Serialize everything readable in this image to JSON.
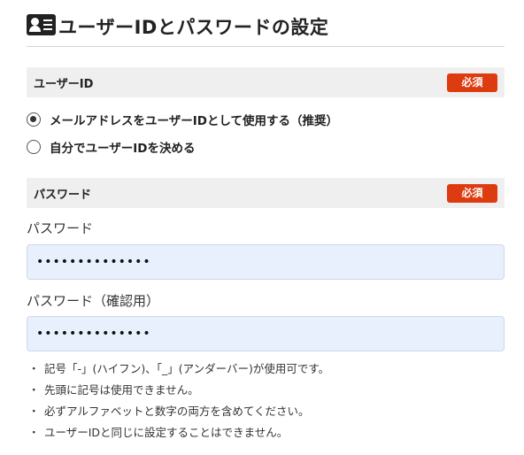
{
  "header": {
    "icon": "id-card-icon",
    "title": "ユーザーIDとパスワードの設定"
  },
  "userid_section": {
    "label": "ユーザーID",
    "required_label": "必須",
    "options": [
      {
        "label": "メールアドレスをユーザーIDとして使用する（推奨）",
        "checked": true
      },
      {
        "label": "自分でユーザーIDを決める",
        "checked": false
      }
    ]
  },
  "password_section": {
    "label": "パスワード",
    "required_label": "必須",
    "password_label": "パスワード",
    "password_value": "••••••••••••••",
    "confirm_label": "パスワード（確認用）",
    "confirm_value": "••••••••••••••"
  },
  "notes": {
    "bullet": "・",
    "items": [
      "記号「-」(ハイフン)、「_」(アンダーバー)が使用可です。",
      "先頭に記号は使用できません。",
      "必ずアルファベットと数字の両方を含めてください。",
      "ユーザーIDと同じに設定することはできません。"
    ]
  },
  "colors": {
    "required_badge": "#dd3c10",
    "input_background": "#e8f0fe",
    "section_background": "#efefef"
  }
}
